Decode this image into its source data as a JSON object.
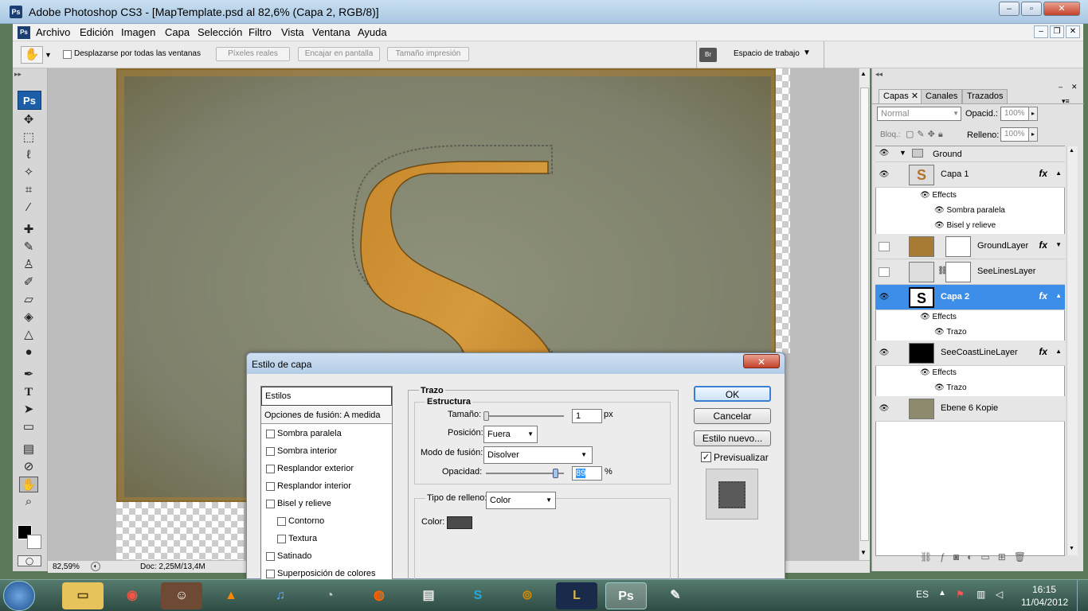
{
  "window": {
    "title": "Adobe Photoshop CS3 - [MapTemplate.psd al 82,6% (Capa 2, RGB/8)]",
    "ps_icon": "Ps"
  },
  "menu": [
    "Archivo",
    "Edición",
    "Imagen",
    "Capa",
    "Selección",
    "Filtro",
    "Vista",
    "Ventana",
    "Ayuda"
  ],
  "options": {
    "scroll_all": "Desplazarse por todas las ventanas",
    "actual_pixels": "Píxeles reales",
    "fit_screen": "Encajar en pantalla",
    "print_size": "Tamaño impresión",
    "workspace": "Espacio de trabajo"
  },
  "status": {
    "zoom": "82,59%",
    "doc": "Doc: 2,25M/13,4M"
  },
  "layers_panel": {
    "tabs": [
      "Capas",
      "Canales",
      "Trazados"
    ],
    "blend_mode": "Normal",
    "opacity_label": "Opacid.:",
    "opacity": "100%",
    "lock_label": "Bloq.:",
    "fill_label": "Relleno:",
    "fill": "100%"
  },
  "layers": {
    "group": "Ground",
    "capa1": "Capa 1",
    "effects": "Effects",
    "sombra": "Sombra paralela",
    "bisel": "Bisel y relieve",
    "ground_layer": "GroundLayer",
    "seelines": "SeeLinesLayer",
    "capa2": "Capa 2",
    "trazo": "Trazo",
    "seecoast": "SeeCoastLineLayer",
    "ebene": "Ebene 6 Kopie"
  },
  "dialog": {
    "title": "Estilo de capa",
    "styles_header": "Estilos",
    "blend_options": "Opciones de fusión: A medida",
    "items": [
      "Sombra paralela",
      "Sombra interior",
      "Resplandor exterior",
      "Resplandor interior",
      "Bisel y relieve",
      "Contorno",
      "Textura",
      "Satinado",
      "Superposición de colores"
    ],
    "section": "Trazo",
    "structure": "Estructura",
    "size_label": "Tamaño:",
    "size": "1",
    "size_unit": "px",
    "position_label": "Posición:",
    "position": "Fuera",
    "blend_label": "Modo de fusión:",
    "blend": "Disolver",
    "opacity_label": "Opacidad:",
    "opacity": "89",
    "opacity_unit": "%",
    "opacity_level": 0.89,
    "fill_type_label": "Tipo de relleno:",
    "fill_type": "Color",
    "color_label": "Color:",
    "ok": "OK",
    "cancel": "Cancelar",
    "new_style": "Estilo nuevo...",
    "preview": "Previsualizar"
  },
  "taskbar": {
    "lang": "ES",
    "time": "16:15",
    "date": "11/04/2012",
    "ps": "Ps"
  }
}
